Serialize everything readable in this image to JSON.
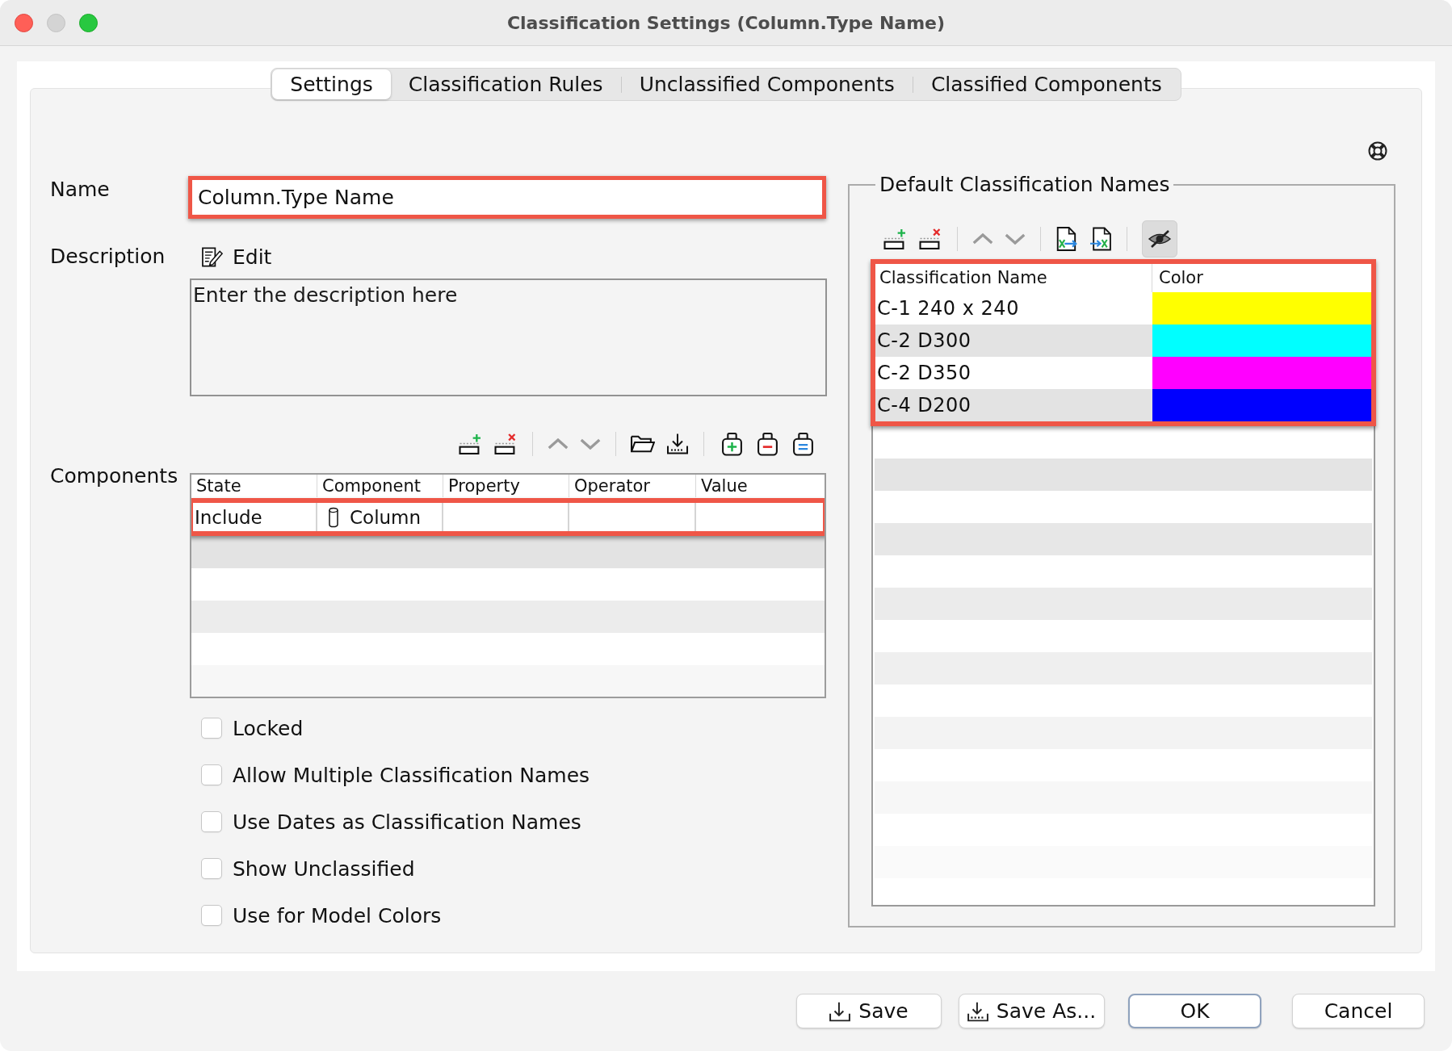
{
  "window": {
    "title": "Classification Settings (Column.Type Name)",
    "minimize_disabled": true
  },
  "tabs": [
    {
      "label": "Settings",
      "selected": true
    },
    {
      "label": "Classification Rules",
      "selected": false
    },
    {
      "label": "Unclassified Components",
      "selected": false
    },
    {
      "label": "Classified Components",
      "selected": false
    }
  ],
  "name": {
    "label": "Name",
    "value": "Column.Type Name",
    "highlighted": true
  },
  "description": {
    "label": "Description",
    "edit": "Edit",
    "placeholder": "Enter the description here"
  },
  "components": {
    "label": "Components",
    "columns": [
      "State",
      "Component",
      "Property",
      "Operator",
      "Value"
    ],
    "rows": [
      {
        "state": "Include",
        "component": "Column",
        "highlighted": true
      }
    ]
  },
  "options": [
    {
      "label": "Locked",
      "checked": false
    },
    {
      "label": "Allow Multiple Classification Names",
      "checked": false
    },
    {
      "label": "Use Dates as Classification Names",
      "checked": false
    },
    {
      "label": "Show Unclassified",
      "checked": false
    },
    {
      "label": "Use for Model Colors",
      "checked": false
    }
  ],
  "default_names": {
    "title": "Default Classification Names",
    "eye_toggle": {
      "on": true
    },
    "highlighted": true,
    "columns": [
      "Classification Name",
      "Color"
    ],
    "rows": [
      {
        "name": "C-1 240 x 240",
        "color": "#ffff00"
      },
      {
        "name": "C-2 D300",
        "color": "#00ffff"
      },
      {
        "name": "C-2 D350",
        "color": "#ff00ff"
      },
      {
        "name": "C-4 D200",
        "color": "#0000ff"
      }
    ]
  },
  "buttons": [
    {
      "label": "Save",
      "kind": "save"
    },
    {
      "label": "Save As...",
      "kind": "save-as"
    },
    {
      "label": "OK",
      "kind": "default"
    },
    {
      "label": "Cancel",
      "kind": "plain"
    }
  ]
}
